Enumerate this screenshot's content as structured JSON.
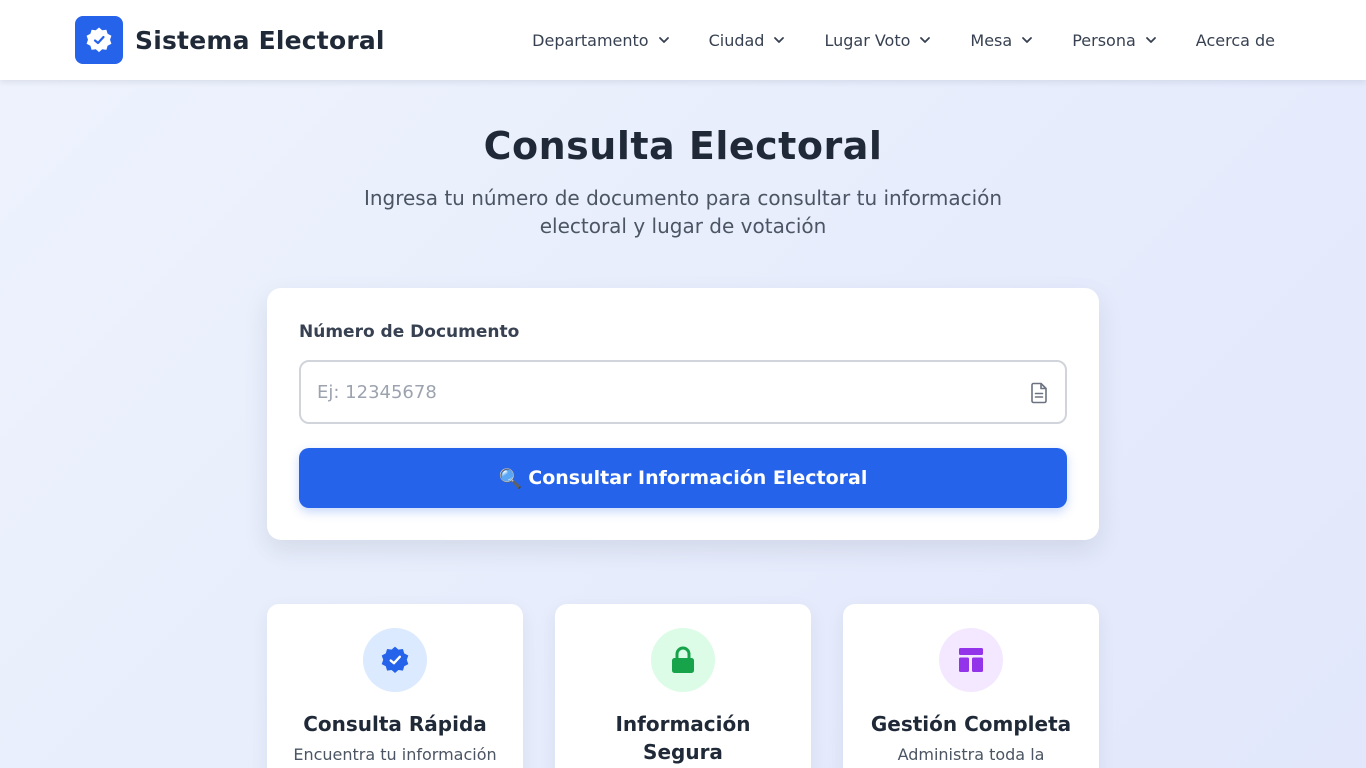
{
  "header": {
    "brand_title": "Sistema Electoral",
    "nav": [
      {
        "label": "Departamento",
        "has_dropdown": true
      },
      {
        "label": "Ciudad",
        "has_dropdown": true
      },
      {
        "label": "Lugar Voto",
        "has_dropdown": true
      },
      {
        "label": "Mesa",
        "has_dropdown": true
      },
      {
        "label": "Persona",
        "has_dropdown": true
      },
      {
        "label": "Acerca de",
        "has_dropdown": false
      }
    ]
  },
  "hero": {
    "title": "Consulta Electoral",
    "subtitle": "Ingresa tu número de documento para consultar tu información electoral y lugar de votación"
  },
  "search": {
    "label": "Número de Documento",
    "placeholder": "Ej: 12345678",
    "value": "",
    "button_icon": "🔍",
    "button_label": "Consultar Información Electoral"
  },
  "features": [
    {
      "icon": "check-badge-icon",
      "title": "Consulta Rápida",
      "description": "Encuentra tu información",
      "color": "#2563eb",
      "bg": "#dbeafe"
    },
    {
      "icon": "lock-icon",
      "title": "Información Segura",
      "description": "",
      "color": "#16a34a",
      "bg": "#dcfce7"
    },
    {
      "icon": "layout-icon",
      "title": "Gestión Completa",
      "description": "Administra toda la",
      "color": "#9333ea",
      "bg": "#f3e8ff"
    }
  ],
  "colors": {
    "primary": "#2563eb",
    "text_dark": "#1f2937",
    "text_muted": "#4b5563"
  }
}
